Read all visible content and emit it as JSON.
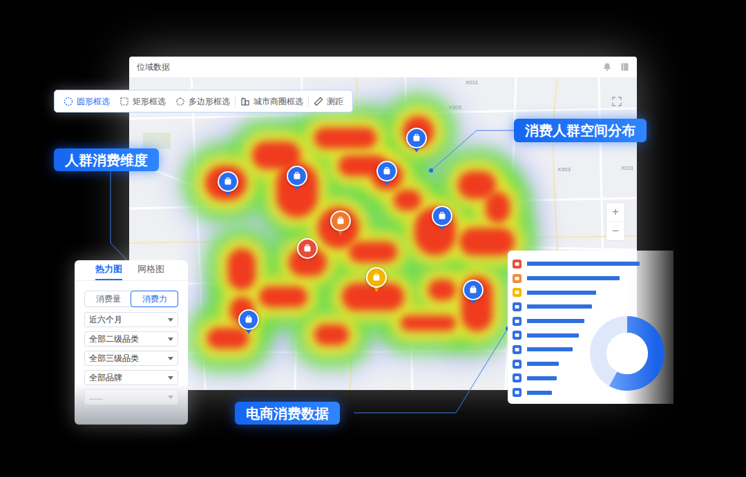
{
  "window": {
    "title": "位域数据"
  },
  "toolbar": [
    {
      "label": "圆形框选",
      "selected": true
    },
    {
      "label": "矩形框选",
      "selected": false
    },
    {
      "label": "多边形框选",
      "selected": false
    },
    {
      "label": "城市商圈框选",
      "selected": false
    },
    {
      "label": "测距",
      "selected": false
    }
  ],
  "callouts": {
    "dimension": "人群消费维度",
    "distribution": "消费人群空间分布",
    "ecommerce": "电商消费数据"
  },
  "map": {
    "labels": [
      "X011",
      "X303",
      "X303",
      "X011"
    ],
    "zoom": [
      "+",
      "−"
    ],
    "pins": [
      {
        "color": "#2a6ef0"
      },
      {
        "color": "#2a6ef0"
      },
      {
        "color": "#2a6ef0"
      },
      {
        "color": "#2a6ef0"
      },
      {
        "color": "#f07a2c"
      },
      {
        "color": "#2a6ef0"
      },
      {
        "color": "#e94a3a"
      },
      {
        "color": "#f4b400"
      },
      {
        "color": "#2a6ef0"
      },
      {
        "color": "#2a6ef0"
      }
    ]
  },
  "filter_panel": {
    "tabs": [
      {
        "label": "热力图",
        "selected": true
      },
      {
        "label": "网格图",
        "selected": false
      }
    ],
    "modes": [
      {
        "label": "消费量",
        "selected": false
      },
      {
        "label": "消费力",
        "selected": true
      }
    ],
    "dropdowns": [
      {
        "value": "近六个月",
        "disabled": false
      },
      {
        "value": "全部二级品类",
        "disabled": false
      },
      {
        "value": "全部三级品类",
        "disabled": false
      },
      {
        "value": "全部品牌",
        "disabled": false
      },
      {
        "value": "......",
        "disabled": true
      }
    ]
  },
  "chart": {
    "bars": [
      {
        "color": "#e8503a",
        "level": 0.96
      },
      {
        "color": "#f08a3c",
        "level": 0.79
      },
      {
        "color": "#f5b800",
        "level": 0.59
      },
      {
        "color": "#2f6fe0",
        "level": 0.55
      },
      {
        "color": "#2f6fe0",
        "level": 0.49
      },
      {
        "color": "#2f6fe0",
        "level": 0.44
      },
      {
        "color": "#2f6fe0",
        "level": 0.39
      },
      {
        "color": "#2f6fe0",
        "level": 0.27
      },
      {
        "color": "#2f6fe0",
        "level": 0.25
      },
      {
        "color": "#2f6fe0",
        "level": 0.21
      }
    ],
    "donut": [
      58,
      42
    ]
  }
}
